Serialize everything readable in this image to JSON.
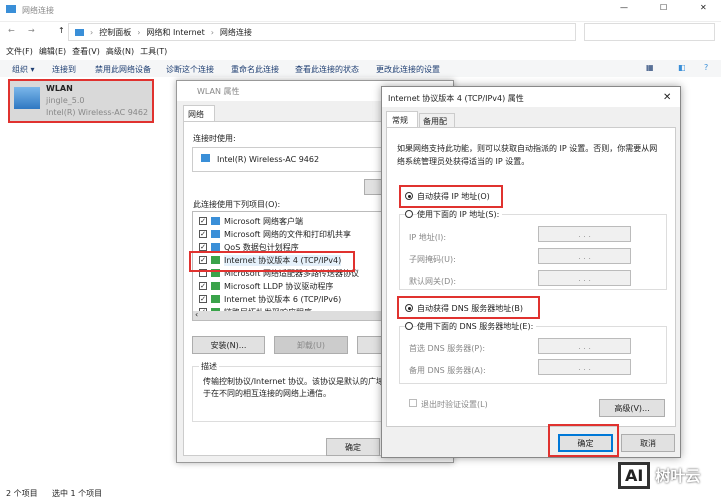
{
  "window": {
    "title": "网络连接"
  },
  "address": {
    "crumbs": [
      "控制面板",
      "网络和 Internet",
      "网络连接"
    ],
    "sep": "›"
  },
  "menu": [
    "文件(F)",
    "编辑(E)",
    "查看(V)",
    "高级(N)",
    "工具(T)"
  ],
  "toolbar": [
    "组织 ▾",
    "连接到",
    "禁用此网络设备",
    "诊断这个连接",
    "重命名此连接",
    "查看此连接的状态",
    "更改此连接的设置"
  ],
  "adapter": {
    "name": "WLAN",
    "ssid": "jingle_5.0",
    "device": "Intel(R) Wireless-AC 9462"
  },
  "wlan_dialog": {
    "title": "WLAN 属性",
    "tab": "网络",
    "connect_using_label": "连接时使用:",
    "adapter": "Intel(R) Wireless-AC 9462",
    "items_label": "此连接使用下列项目(O):",
    "items": [
      {
        "label": "Microsoft 网络客户端",
        "checked": true
      },
      {
        "label": "Microsoft 网络的文件和打印机共享",
        "checked": true
      },
      {
        "label": "QoS 数据包计划程序",
        "checked": true
      },
      {
        "label": "Internet 协议版本 4 (TCP/IPv4)",
        "checked": true
      },
      {
        "label": "Microsoft 网络适配器多路传送器协议",
        "checked": false
      },
      {
        "label": "Microsoft LLDP 协议驱动程序",
        "checked": true
      },
      {
        "label": "Internet 协议版本 6 (TCP/IPv6)",
        "checked": true
      },
      {
        "label": "链路层拓扑发现响应程序",
        "checked": true
      }
    ],
    "install": "安装(N)...",
    "uninstall": "卸载(U)",
    "properties": "属",
    "desc_label": "描述",
    "desc": "传输控制协议/Internet 协议。该协议是默认的广域网",
    "desc2": "于在不同的相互连接的网络上通信。",
    "ok": "确定"
  },
  "ipv4_dialog": {
    "title": "Internet 协议版本 4 (TCP/IPv4) 属性",
    "close": "✕",
    "tabs": [
      "常规",
      "备用配置"
    ],
    "intro1": "如果网络支持此功能，则可以获取自动指派的 IP 设置。否则，你需要从网",
    "intro2": "络系统管理员处获得适当的 IP 设置。",
    "auto_ip": "自动获得 IP 地址(O)",
    "manual_ip": "使用下面的 IP 地址(S):",
    "ip_label": "IP 地址(I):",
    "mask_label": "子网掩码(U):",
    "gateway_label": "默认网关(D):",
    "auto_dns": "自动获得 DNS 服务器地址(B)",
    "manual_dns": "使用下面的 DNS 服务器地址(E):",
    "dns1_label": "首选 DNS 服务器(P):",
    "dns2_label": "备用 DNS 服务器(A):",
    "validate": "退出时验证设置(L)",
    "advanced": "高级(V)...",
    "ok": "确定",
    "cancel": "取消",
    "dots": ". . ."
  },
  "status": {
    "count": "2 个项目",
    "selected": "选中 1 个项目"
  },
  "watermark": {
    "logo": "AI",
    "text": "树叶云"
  }
}
